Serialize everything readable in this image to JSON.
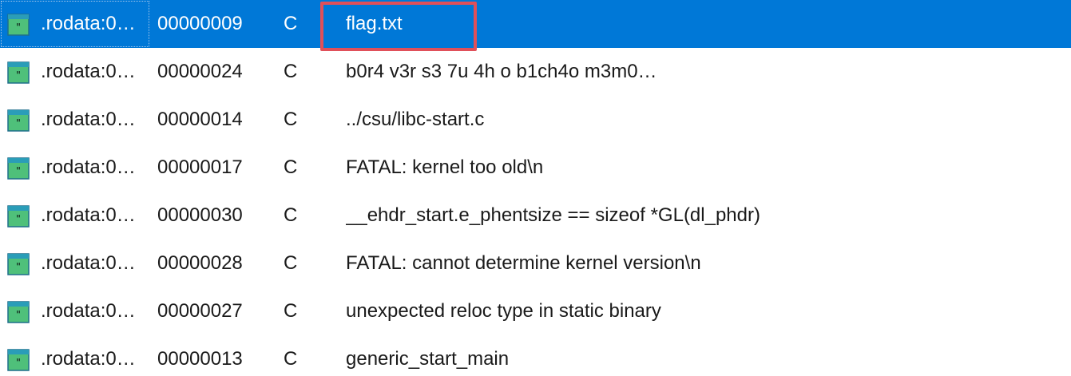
{
  "strings_view": {
    "rows": [
      {
        "address": ".rodata:0…",
        "length": "00000009",
        "type": "C",
        "string": "flag.txt",
        "selected": true
      },
      {
        "address": ".rodata:0…",
        "length": "00000024",
        "type": "C",
        "string": "b0r4 v3r s3 7u 4h o b1ch4o m3m0…"
      },
      {
        "address": ".rodata:0…",
        "length": "00000014",
        "type": "C",
        "string": "../csu/libc-start.c"
      },
      {
        "address": ".rodata:0…",
        "length": "00000017",
        "type": "C",
        "string": "FATAL: kernel too old\\n"
      },
      {
        "address": ".rodata:0…",
        "length": "00000030",
        "type": "C",
        "string": "__ehdr_start.e_phentsize == sizeof *GL(dl_phdr)"
      },
      {
        "address": ".rodata:0…",
        "length": "00000028",
        "type": "C",
        "string": "FATAL: cannot determine kernel version\\n"
      },
      {
        "address": ".rodata:0…",
        "length": "00000027",
        "type": "C",
        "string": "unexpected reloc type in static binary"
      },
      {
        "address": ".rodata:0…",
        "length": "00000013",
        "type": "C",
        "string": "generic_start_main"
      }
    ],
    "row_icon": "string-literal-icon",
    "colors": {
      "selection": "#0078d7",
      "highlight_border": "#e0505a",
      "icon_green": "#4fc07a",
      "icon_teal": "#2a9db8"
    }
  }
}
